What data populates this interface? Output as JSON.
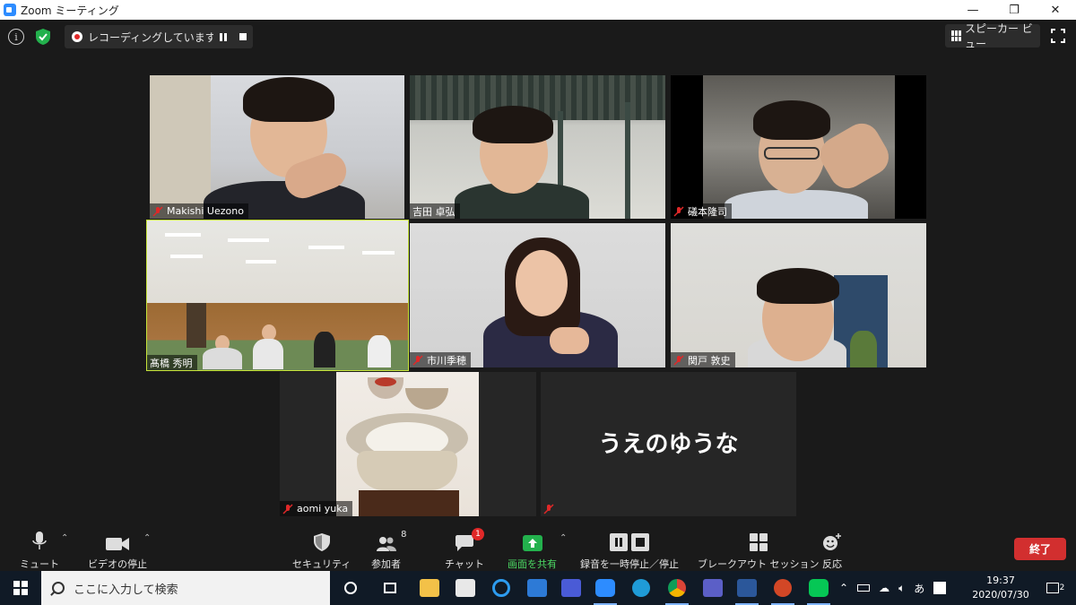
{
  "window": {
    "title": "Zoom ミーティング",
    "controls": {
      "minimize": "—",
      "restore": "❐",
      "close": "✕"
    }
  },
  "topbar": {
    "info_icon": "info-icon",
    "security_icon": "shield-check-icon",
    "recording_label": "レコーディングしています...",
    "view_label": "スピーカー ビュー"
  },
  "participants": [
    {
      "name": "Makishi Uezono",
      "muted": true,
      "video": true
    },
    {
      "name": "吉田 卓弘",
      "muted": false,
      "video": true
    },
    {
      "name": "礒本隆司",
      "muted": true,
      "video": true
    },
    {
      "name": "髙橋 秀明",
      "muted": false,
      "video": true,
      "active_speaker": true
    },
    {
      "name": "市川季穂",
      "muted": true,
      "video": true
    },
    {
      "name": "関戸 敦史",
      "muted": true,
      "video": true
    },
    {
      "name": "aomi yuka",
      "muted": true,
      "video": true
    },
    {
      "name": "",
      "muted": true,
      "video": false,
      "display_text": "うえのゆうな"
    }
  ],
  "controls": {
    "mute": "ミュート",
    "stop_video": "ビデオの停止",
    "security": "セキュリティ",
    "participants": "参加者",
    "participants_count": "8",
    "chat": "チャット",
    "chat_badge": "1",
    "share_screen": "画面を共有",
    "record": "録音を一時停止／停止",
    "breakout": "ブレークアウト セッション",
    "reactions": "反応",
    "end": "終了"
  },
  "taskbar": {
    "search_placeholder": "ここに入力して検索",
    "ime": "あ",
    "time": "19:37",
    "date": "2020/07/30",
    "notifications": "2"
  },
  "colors": {
    "accent_green": "#4cd964",
    "active_speaker": "#c7e43a",
    "end_red": "#d22f2f",
    "badge_red": "#e02828",
    "zoom_blue": "#2d8cff"
  }
}
